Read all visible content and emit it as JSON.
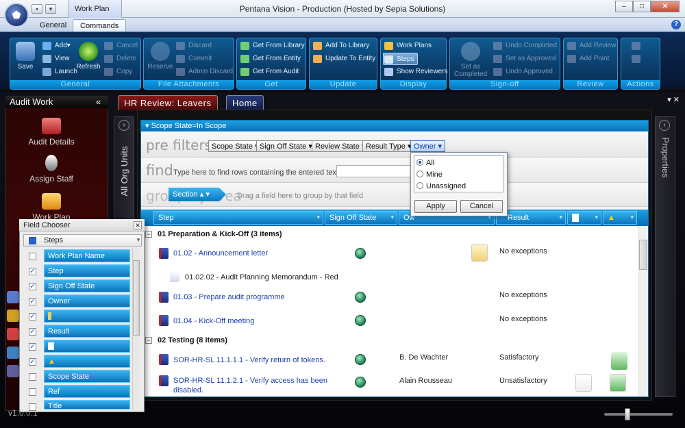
{
  "window": {
    "title": "Pentana Vision - Production (Hosted by Sepia Solutions)",
    "context_tab": "Work Plan",
    "controls": [
      "–",
      "□",
      "✕"
    ]
  },
  "ribbon_tabs": [
    {
      "label": "General",
      "active": false
    },
    {
      "label": "Commands",
      "active": true
    }
  ],
  "help": "?",
  "ribbon": {
    "general": {
      "label": "General",
      "save": "Save",
      "add": "Add",
      "view": "View",
      "launch": "Launch",
      "refresh": "Refresh",
      "cancel": "Cancel",
      "delete": "Delete",
      "copy": "Copy"
    },
    "file_attachments": {
      "label": "File Attachments",
      "reserve": "Reserve",
      "discard": "Discard",
      "commit": "Commit",
      "admin_discard": "Admin Discard"
    },
    "get": {
      "label": "Get",
      "from_library": "Get From Library",
      "from_entity": "Get From Entity",
      "from_audit": "Get From Audit"
    },
    "update": {
      "label": "Update",
      "add_to_library": "Add To Library",
      "update_to_entity": "Update To Entity"
    },
    "display": {
      "label": "Display",
      "work_plans": "Work Plans",
      "steps": "Steps",
      "show_reviewers": "Show Reviewers"
    },
    "signoff": {
      "label": "Sign-off",
      "set_as_completed": "Set as Completed",
      "undo_completed": "Undo Completed",
      "set_as_approved": "Set as Approved",
      "undo_approved": "Undo Approved"
    },
    "review": {
      "label": "Review",
      "add_review": "Add Review",
      "add_point": "Add Point"
    },
    "actions": {
      "label": "Actions"
    }
  },
  "audit_work": {
    "title": "Audit Work",
    "collapse": "«",
    "items": [
      "Audit Details",
      "Assign Staff",
      "Work Plan"
    ],
    "version": "v1.0.0.1"
  },
  "doc_tabs": [
    {
      "label": "HR Review: Leavers",
      "active": true
    },
    {
      "label": "Home",
      "active": false
    }
  ],
  "tab_controls": "▾ ✕",
  "side_panels": {
    "left": "All Org Units",
    "right": "Properties"
  },
  "grid": {
    "scope_bar": "Scope State=In Scope",
    "prefilters_label": "pre filters",
    "prefilter_buttons": [
      "Scope State",
      "Sign Off State",
      "Review State",
      "Result Type",
      "Owner"
    ],
    "find_label": "find",
    "find_hint": "Type here to find rows containing the entered text:",
    "find_value": "",
    "group_label": "group by area",
    "group_chip": "Section",
    "group_hint": "Drag a field here to group by that field",
    "columns": [
      "Step",
      "Sign Off State",
      "Ow",
      "Result"
    ],
    "groups": [
      {
        "title": "01 Preparation & Kick-Off (3 items)",
        "rows": [
          {
            "step": "01.02 - Announcement letter",
            "owner": "",
            "result": "No exceptions"
          },
          {
            "step": "01.02.02 - Audit Planning Memorandum - Red",
            "owner": "",
            "result": ""
          },
          {
            "step": "01.03 - Prepare audit programme",
            "owner": "",
            "result": "No exceptions"
          },
          {
            "step": "01.04 - Kick-Off meeting",
            "owner": "",
            "result": "No exceptions"
          }
        ]
      },
      {
        "title": "02 Testing (8 items)",
        "rows": [
          {
            "step": "SOR-HR-SL 11.1.1.1 - Verify return of tokens.",
            "owner": "B. De Wachter",
            "result": "Satisfactory"
          },
          {
            "step": "SOR-HR-SL 11.1.2.1 - Verify access has been",
            "step2": "disabled.",
            "owner": "Alain Rousseau",
            "result": "Unsatisfactory"
          }
        ]
      }
    ]
  },
  "owner_popup": {
    "options": [
      {
        "label": "All",
        "selected": true
      },
      {
        "label": "Mine",
        "selected": false
      },
      {
        "label": "Unassigned",
        "selected": false
      }
    ],
    "apply": "Apply",
    "cancel": "Cancel"
  },
  "field_chooser": {
    "title": "Field Chooser",
    "close": "✕",
    "header": "Steps",
    "fields": [
      {
        "label": "Work Plan Name",
        "checked": false
      },
      {
        "label": "Step",
        "checked": true
      },
      {
        "label": "Sign Off State",
        "checked": true
      },
      {
        "label": "Owner",
        "checked": true
      },
      {
        "label": "",
        "icon": "status-icon",
        "checked": true
      },
      {
        "label": "Result",
        "checked": true
      },
      {
        "label": "",
        "icon": "document-icon",
        "checked": true
      },
      {
        "label": "",
        "icon": "warning-icon",
        "checked": true
      },
      {
        "label": "Scope State",
        "checked": false
      },
      {
        "label": "Ref",
        "checked": false
      },
      {
        "label": "Title",
        "checked": false
      }
    ]
  },
  "colors": {
    "accent": "#0a78c0",
    "ribbon": "#0b3e6c",
    "link": "#1a3ea8",
    "hr_tab": "#6a1010",
    "home_tab": "#1a2a60"
  }
}
